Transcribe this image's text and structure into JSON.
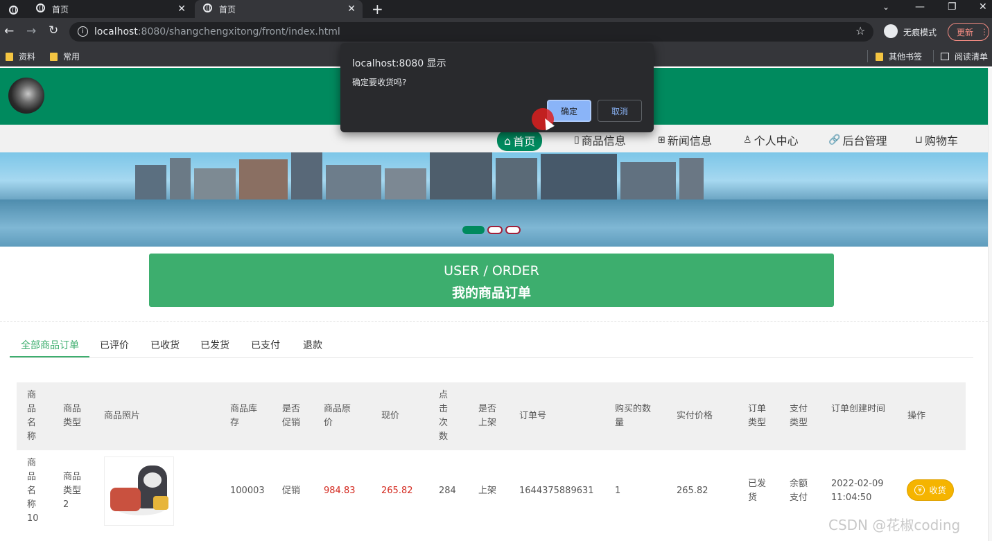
{
  "browser": {
    "tabs": [
      {
        "label": "首页"
      },
      {
        "label": "首页"
      }
    ],
    "url_host": "localhost",
    "url_rest": ":8080/shangchengxitong/front/index.html",
    "profile_label": "无痕模式",
    "update_label": "更新",
    "bookmarks": [
      {
        "label": "资料"
      },
      {
        "label": "常用"
      }
    ],
    "other_bookmarks": "其他书签",
    "reading_list": "阅读清单"
  },
  "nav": {
    "items": [
      {
        "label": "首页"
      },
      {
        "label": "商品信息"
      },
      {
        "label": "新闻信息"
      },
      {
        "label": "个人中心"
      },
      {
        "label": "后台管理"
      },
      {
        "label": "购物车"
      }
    ]
  },
  "banner_title": {
    "en": "USER / ORDER",
    "cn": "我的商品订单"
  },
  "order_tabs": [
    {
      "label": "全部商品订单"
    },
    {
      "label": "已评价"
    },
    {
      "label": "已收货"
    },
    {
      "label": "已发货"
    },
    {
      "label": "已支付"
    },
    {
      "label": "退款"
    }
  ],
  "table": {
    "headers": [
      "商品名称",
      "商品类型",
      "商品照片",
      "商品库存",
      "是否促销",
      "商品原价",
      "现价",
      "点击次数",
      "是否上架",
      "订单号",
      "购买的数量",
      "实付价格",
      "订单类型",
      "支付类型",
      "订单创建时间",
      "操作"
    ],
    "rows": [
      {
        "name": "商品名称10",
        "type": "商品类型2",
        "stock": "100003",
        "promo": "促销",
        "original_price": "984.83",
        "price": "265.82",
        "clicks": "284",
        "on_shelf": "上架",
        "order_no": "1644375889631",
        "quantity": "1",
        "paid": "265.82",
        "order_type": "已发货",
        "pay_type": "余额支付",
        "created": "2022-02-09 11:04:50",
        "action": "收货"
      }
    ]
  },
  "dialog": {
    "title": "localhost:8080 显示",
    "message": "确定要收货吗?",
    "ok": "确定",
    "cancel": "取消"
  },
  "watermark": "CSDN @花椒coding",
  "colors": {
    "brand": "#008a5e",
    "accent": "#3dae6e",
    "price": "#d3281e",
    "action": "#f5b400"
  }
}
